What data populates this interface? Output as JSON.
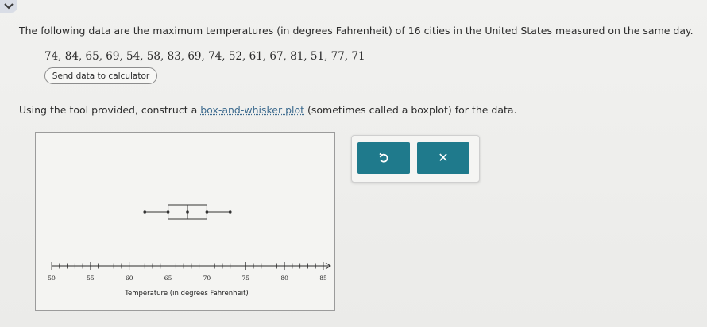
{
  "question": {
    "text": "The following data are the maximum temperatures (in degrees Fahrenheit) of 16 cities in the United States measured on the same day.",
    "data_values": "74, 84, 65, 69, 54, 58, 83, 69, 74, 52, 61, 67, 81, 51, 77, 71",
    "send_button_label": "Send data to calculator"
  },
  "instruction": {
    "prefix": "Using the tool provided, construct a ",
    "link_text": "box-and-whisker plot",
    "suffix": " (sometimes called a boxplot) for the data."
  },
  "plot": {
    "axis_label": "Temperature (in degrees Fahrenheit)",
    "axis_min": 50,
    "axis_max": 85,
    "tick_labels": [
      "50",
      "55",
      "60",
      "65",
      "70",
      "75",
      "80",
      "85"
    ],
    "boxplot": {
      "min": 62,
      "q1": 65,
      "median": 67.5,
      "q3": 70,
      "max": 73
    }
  },
  "tools": {
    "undo_icon": "undo-icon",
    "close_icon": "close-icon"
  },
  "colors": {
    "accent": "#1f7a8c",
    "link": "#3d6b8f"
  }
}
